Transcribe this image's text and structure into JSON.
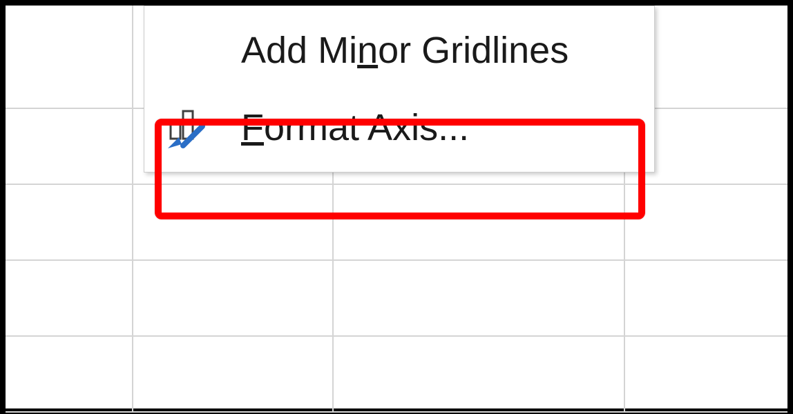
{
  "context_menu": {
    "items": [
      {
        "label_pre": "Add Mi",
        "label_accel": "n",
        "label_post": "or Gridlines",
        "has_icon": false
      },
      {
        "label_pre": "",
        "label_accel": "F",
        "label_post": "ormat Axis...",
        "has_icon": true
      }
    ]
  },
  "highlight": {
    "target": "format-axis-menu-item"
  }
}
